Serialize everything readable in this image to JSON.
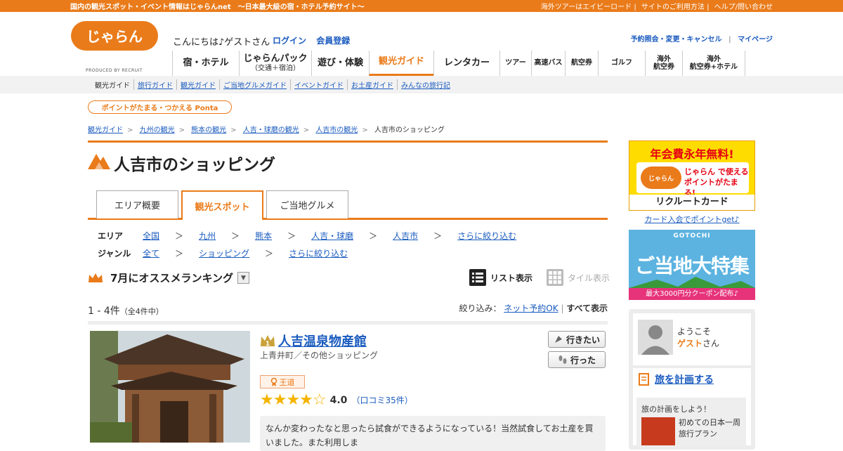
{
  "topbar": {
    "left": "国内の観光スポット・イベント情報はじゃらんnet　～日本最大級の宿・ホテル予約サイト～",
    "right": [
      "海外ツアーはエイビーロード",
      "サイトのご利用方法",
      "ヘルプ/問い合わせ"
    ]
  },
  "header": {
    "logo_text": "じゃらん",
    "produced_by": "PRODUCED BY RECRUIT",
    "greeting": "こんにちは♪ゲストさん",
    "login": "ログイン",
    "register": "会員登録",
    "right_links": [
      "予約照会・変更・キャンセル",
      "マイページ"
    ]
  },
  "nav": [
    {
      "label": "宿・ホテル",
      "sub": ""
    },
    {
      "label": "じゃらんパック",
      "sub": "（交通＋宿泊）"
    },
    {
      "label": "遊び・体験",
      "sub": ""
    },
    {
      "label": "観光ガイド",
      "sub": ""
    },
    {
      "label": "レンタカー",
      "sub": ""
    },
    {
      "label": "ツアー",
      "sub": ""
    },
    {
      "label": "高速バス",
      "sub": ""
    },
    {
      "label": "航空券",
      "sub": ""
    },
    {
      "label": "ゴルフ",
      "sub": ""
    },
    {
      "label": "海外",
      "sub": "航空券"
    },
    {
      "label": "海外",
      "sub": "航空券+ホテル"
    }
  ],
  "subnav": [
    "観光ガイド",
    "旅行ガイド",
    "観光ガイド",
    "ご当地グルメガイド",
    "イベントガイド",
    "お土産ガイド",
    "みんなの旅行記"
  ],
  "ponta": "ポイントがたまる・つかえる Ponta",
  "breadcrumbs": [
    "観光ガイド",
    "九州の観光",
    "熊本の観光",
    "人吉・球磨の観光",
    "人吉市の観光",
    "人吉市のショッピング"
  ],
  "page_title": "人吉市のショッピング",
  "tabs": [
    "エリア概要",
    "観光スポット",
    "ご当地グルメ"
  ],
  "filters": {
    "area_label": "エリア",
    "area": [
      "全国",
      "九州",
      "熊本",
      "人吉・球磨",
      "人吉市",
      "さらに絞り込む"
    ],
    "genre_label": "ジャンル",
    "genre": [
      "全て",
      "ショッピング",
      "さらに絞り込む"
    ],
    "sep": "＞"
  },
  "ranking": {
    "label": "7月にオススメランキング",
    "dropdown": "▼"
  },
  "view": {
    "list": "リスト表示",
    "tile": "タイル表示"
  },
  "count": {
    "main": "1 - 4件",
    "sub": "（全4件中）"
  },
  "narrow": {
    "label": "絞り込み：",
    "opt1": "ネット予約OK",
    "opt2": "すべて表示"
  },
  "spot": {
    "name": "人吉温泉物産館",
    "sub": "上青井町／その他ショッピング",
    "want": "行きたい",
    "went": "行った",
    "badge": "王道",
    "stars": "★★★★☆",
    "score": "4.0",
    "reviews": "（口コミ35件）",
    "review_text": "なんか変わったなと思ったら試食ができるようになっている！当然試食してお土産を買いました。また利用しま"
  },
  "ad1": {
    "title": "年会費永年無料!",
    "mid1": "じゃらん で使える",
    "mid2": "ポイントがたまる!",
    "card": "リクルートカード",
    "link": "カード入会でポイントget♪"
  },
  "ad2": {
    "gotochi": "GOTOCHI",
    "main": "ご当地大特集",
    "bottom": "最大3000円分クーポン配布♪"
  },
  "user": {
    "welcome": "ようこそ",
    "guest": "ゲスト",
    "san": "さん"
  },
  "plan": {
    "title": "旅を計画する",
    "sub": "旅の計画をしよう！",
    "item1": "初めての日本一周",
    "item2": "旅行プラン"
  }
}
